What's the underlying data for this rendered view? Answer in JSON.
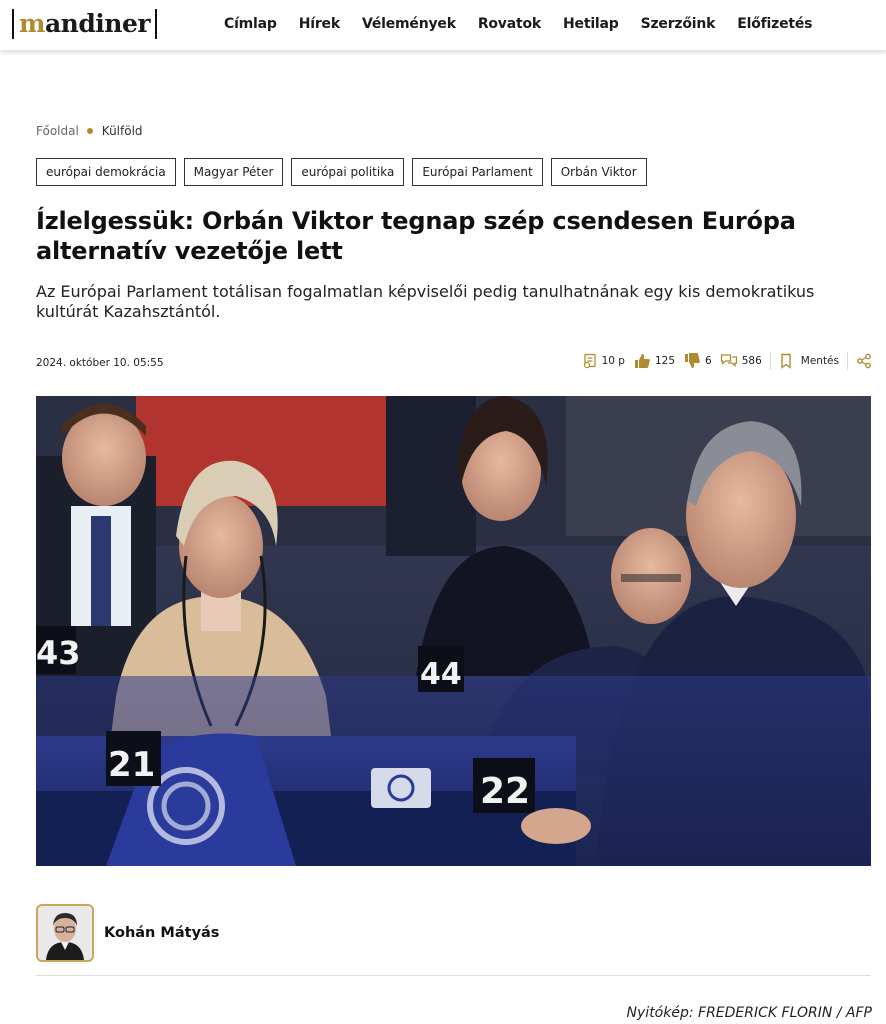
{
  "header": {
    "logo_prefix": "m",
    "logo_rest": "andiner",
    "nav": [
      "Címlap",
      "Hírek",
      "Vélemények",
      "Rovatok",
      "Hetilap",
      "Szerzőink",
      "Előfizetés"
    ]
  },
  "breadcrumb": {
    "home": "Főoldal",
    "section": "Külföld"
  },
  "tags": [
    "európai demokrácia",
    "Magyar Péter",
    "európai politika",
    "Európai Parlament",
    "Orbán Viktor"
  ],
  "article": {
    "title": "Ízlelgessük: Orbán Viktor tegnap szép csendesen Európa alternatív vezetője lett",
    "lead": "Az Európai Parlament totálisan fogalmatlan képviselői pedig tanulhatnának egy kis demokratikus kultúrát Kazahsztántól.",
    "date": "2024. október 10. 05:55",
    "reading_time": "10 p",
    "likes": "125",
    "dislikes": "6",
    "comments": "586",
    "save_label": "Mentés"
  },
  "hero": {
    "seat_numbers": [
      "43",
      "44",
      "21",
      "22"
    ]
  },
  "author": {
    "name": "Kohán Mátyás"
  },
  "credit": "Nyitókép: FREDERICK FLORIN / AFP",
  "colors": {
    "accent": "#b08a2f",
    "hero_bg": "#2a3048"
  }
}
